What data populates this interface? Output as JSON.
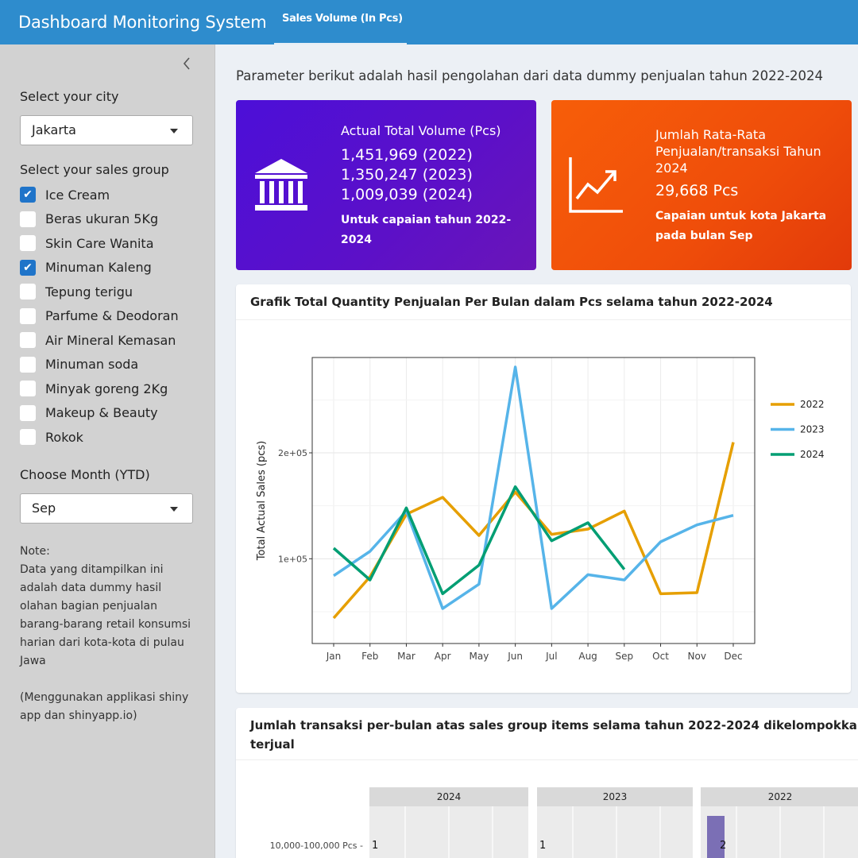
{
  "header": {
    "app_title": "Dashboard Monitoring System",
    "tab_label": "Sales Volume (In Pcs)"
  },
  "sidebar": {
    "collapse_icon": "chevron-left-icon",
    "city_label": "Select your city",
    "city_value": "Jakarta",
    "group_label": "Select your sales group",
    "groups": [
      {
        "label": "Ice Cream",
        "checked": true
      },
      {
        "label": "Beras ukuran 5Kg",
        "checked": false
      },
      {
        "label": "Skin Care Wanita",
        "checked": false
      },
      {
        "label": "Minuman Kaleng",
        "checked": true
      },
      {
        "label": "Tepung terigu",
        "checked": false
      },
      {
        "label": "Parfume & Deodoran",
        "checked": false
      },
      {
        "label": "Air Mineral Kemasan",
        "checked": false
      },
      {
        "label": "Minuman soda",
        "checked": false
      },
      {
        "label": "Minyak goreng 2Kg",
        "checked": false
      },
      {
        "label": "Makeup & Beauty",
        "checked": false
      },
      {
        "label": "Rokok",
        "checked": false
      }
    ],
    "month_label": "Choose Month (YTD)",
    "month_value": "Sep",
    "note_title": "Note:",
    "note_body": "Data yang ditampilkan ini adalah data dummy hasil olahan bagian penjualan barang-barang retail konsumsi harian dari kota-kota di pulau Jawa",
    "note_footer": "(Menggunakan applikasi shiny app dan shinyapp.io)"
  },
  "main": {
    "intro": "Parameter berikut adalah hasil pengolahan dari data dummy penjualan tahun 2022-2024",
    "box_volume": {
      "icon": "bank-icon",
      "color": "#5510cc",
      "title": "Actual Total Volume (Pcs)",
      "lines": [
        "1,451,969 (2022)",
        "1,350,247 (2023)",
        "1,009,039 (2024)"
      ],
      "sub": "Untuk capaian tahun 2022-2024"
    },
    "box_avg": {
      "icon": "line-chart-icon",
      "color": "#f0500a",
      "title": "Jumlah Rata-Rata Penjualan/transaksi Tahun 2024",
      "value": "29,668 Pcs",
      "sub": "Capaian untuk kota Jakarta pada bulan Sep"
    },
    "chart1_title": "Grafik Total Quantity Penjualan Per Bulan dalam Pcs selama tahun 2022-2024",
    "chart2_title_line1": "Jumlah transaksi per-bulan atas sales group items selama tahun 2022-2024 dikelompokkan dalam jumlah",
    "chart2_title_line2": "terjual"
  },
  "chart_data": [
    {
      "type": "line",
      "title": "Grafik Total Quantity Penjualan Per Bulan dalam Pcs selama tahun 2022-2024",
      "xlabel": "",
      "ylabel": "Total Actual Sales (pcs)",
      "categories": [
        "Jan",
        "Feb",
        "Mar",
        "Apr",
        "May",
        "Jun",
        "Jul",
        "Aug",
        "Sep",
        "Oct",
        "Nov",
        "Dec"
      ],
      "y_ticks": [
        100000,
        200000
      ],
      "y_tick_labels": [
        "1e+05",
        "2e+05"
      ],
      "ylim": [
        20000,
        290000
      ],
      "grid": true,
      "legend": "right",
      "series": [
        {
          "name": "2022",
          "color": "#e69f00",
          "values": [
            44000,
            83000,
            142000,
            158000,
            122000,
            163000,
            123000,
            128000,
            145000,
            67000,
            68000,
            210000
          ]
        },
        {
          "name": "2023",
          "color": "#56b4e9",
          "values": [
            84000,
            107000,
            145000,
            53000,
            76000,
            281000,
            53000,
            85000,
            80000,
            116000,
            132000,
            141000
          ]
        },
        {
          "name": "2024",
          "color": "#009e73",
          "values": [
            110000,
            80000,
            148000,
            67000,
            94000,
            168000,
            117000,
            134000,
            90000
          ]
        }
      ]
    },
    {
      "type": "bar",
      "facets": [
        "2024",
        "2023",
        "2022"
      ],
      "categories": [
        "10,000-100,000 Pcs"
      ],
      "series": [
        {
          "name": "2024",
          "values": [
            1
          ]
        },
        {
          "name": "2023",
          "values": [
            1
          ]
        },
        {
          "name": "2022",
          "values": [
            2
          ]
        }
      ],
      "bar_color": "#7b6fb5"
    }
  ]
}
